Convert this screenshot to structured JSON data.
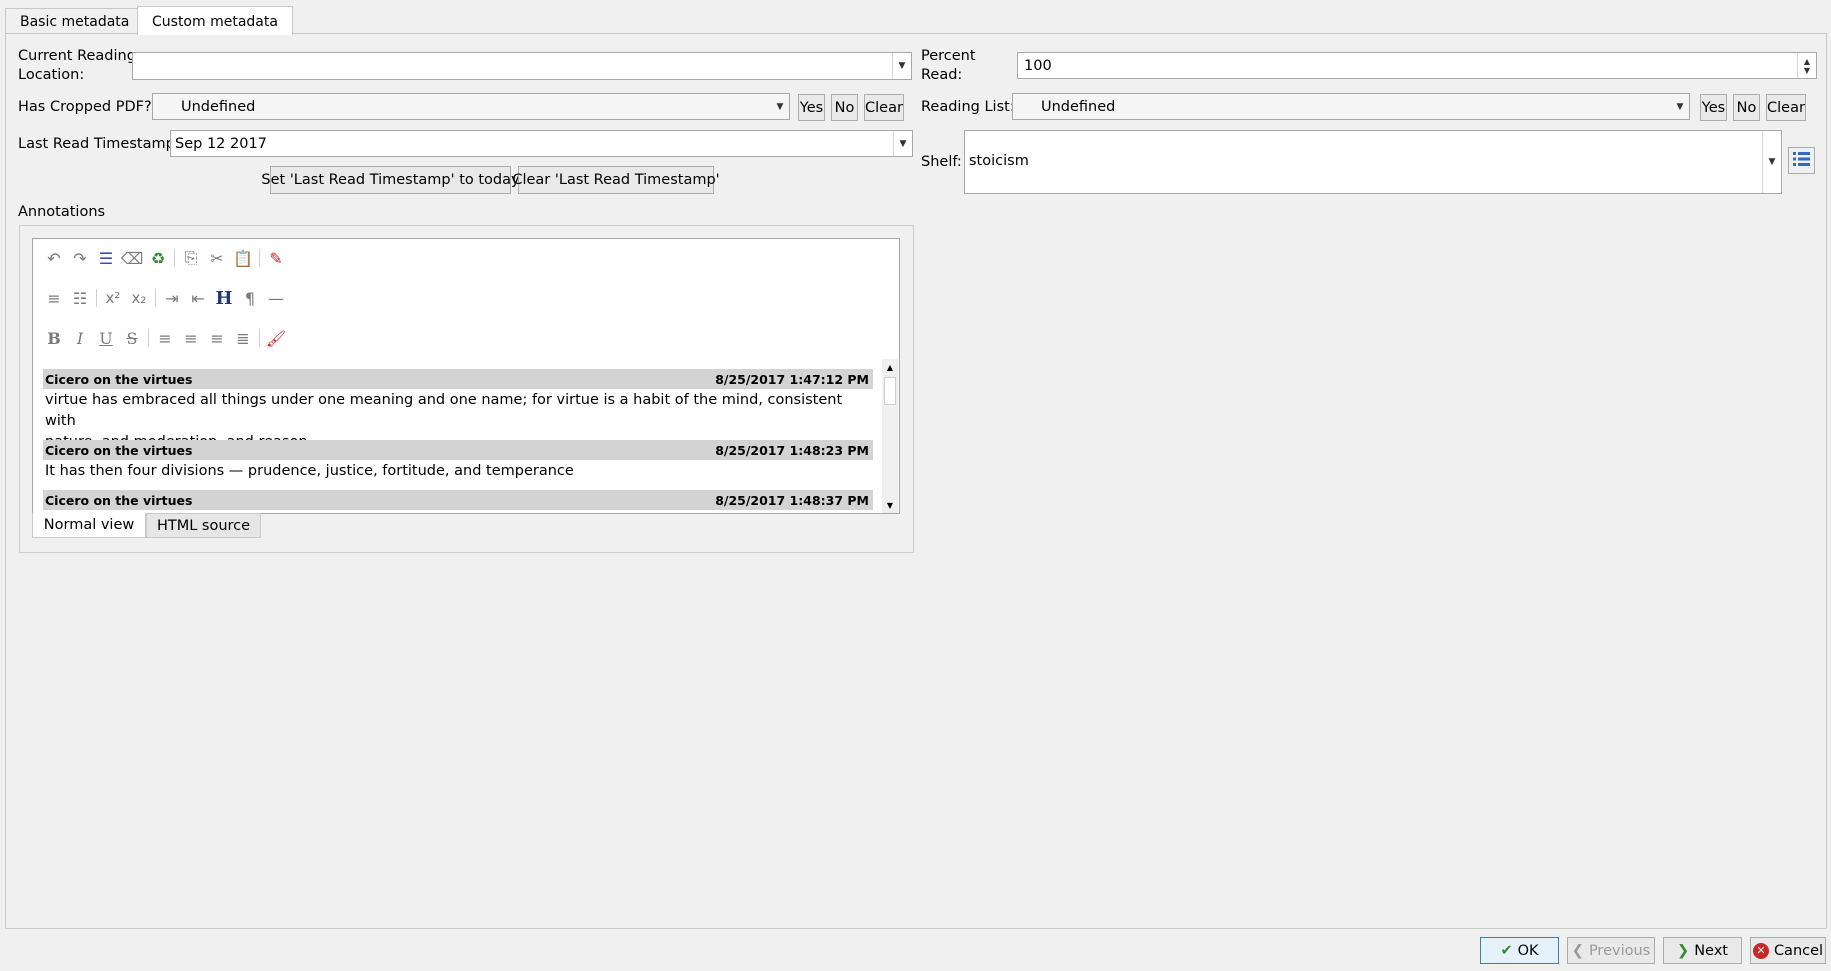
{
  "tabs": [
    {
      "label": "Basic metadata"
    },
    {
      "label": "Custom metadata"
    }
  ],
  "left": {
    "current_reading_location": {
      "label_line1": "Current Reading",
      "label_line2": "Location:",
      "value": ""
    },
    "has_cropped_pdf": {
      "label": "Has Cropped PDF?:",
      "value": "Undefined",
      "yes": "Yes",
      "no": "No",
      "clear": "Clear"
    },
    "last_read_timestamp": {
      "label": "Last Read Timestamp:",
      "value": "Sep 12 2017"
    },
    "set_today_button": "Set 'Last Read Timestamp' to today",
    "clear_ts_button": "Clear 'Last Read Timestamp'",
    "annotations_label": "Annotations"
  },
  "right": {
    "percent_read": {
      "label_line1": "Percent",
      "label_line2": "Read:",
      "value": "100"
    },
    "reading_list": {
      "label": "Reading List:",
      "value": "Undefined",
      "yes": "Yes",
      "no": "No",
      "clear": "Clear"
    },
    "shelf": {
      "label": "Shelf:",
      "value": "stoicism"
    }
  },
  "annotations": [
    {
      "title": "Cicero on the virtues",
      "time": "8/25/2017 1:47:12 PM",
      "line1": " virtue has embraced all things under one meaning and one name; for virtue is a habit of the mind, consistent with",
      "line2": "nature, and moderation, and reason"
    },
    {
      "title": "Cicero on the virtues",
      "time": "8/25/2017 1:48:23 PM",
      "line1": " It has then four divisions — prudence, justice, fortitude, and temperance"
    },
    {
      "title": "Cicero on the virtues",
      "time": "8/25/2017 1:48:37 PM"
    }
  ],
  "editor_tabs": {
    "normal": "Normal view",
    "html": "HTML source"
  },
  "footer": {
    "ok": "OK",
    "previous": "Previous",
    "next": "Next",
    "cancel": "Cancel"
  },
  "colors": {
    "ok_check": "#2e8b2e",
    "cancel_x": "#c62828",
    "shelf_icon": "#2a6ebd"
  }
}
